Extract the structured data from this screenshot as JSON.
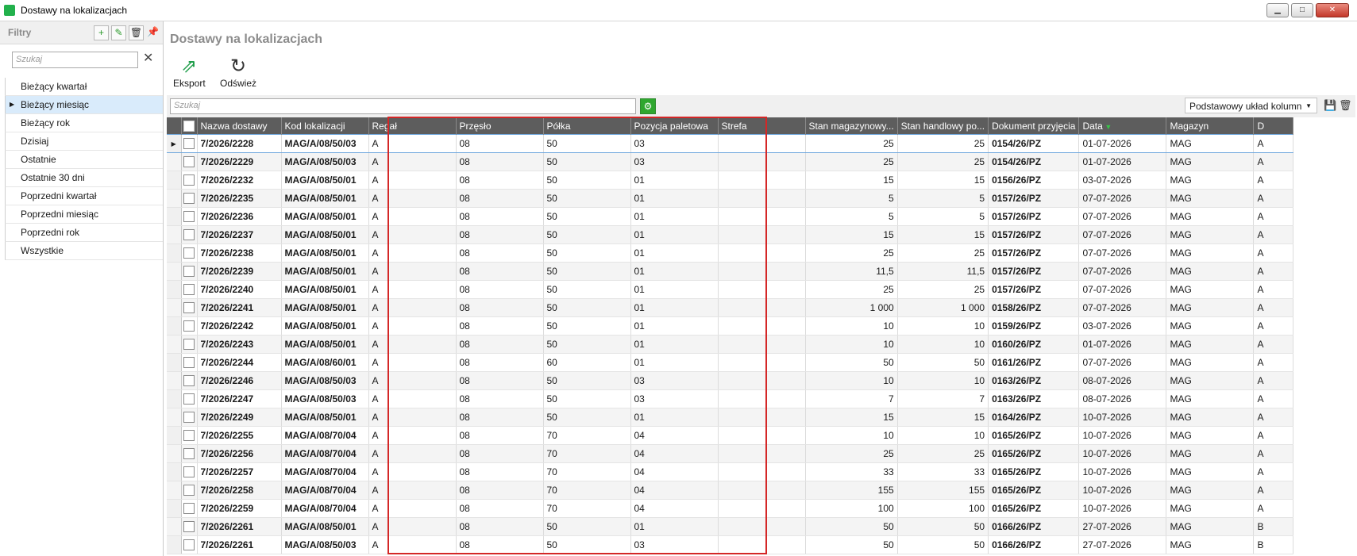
{
  "window": {
    "title": "Dostawy na lokalizacjach",
    "buttons": [
      "▁",
      "□",
      "✕"
    ]
  },
  "filters": {
    "title": "Filtry",
    "search_placeholder": "Szukaj",
    "items": [
      {
        "label": "Bieżący kwartał",
        "selected": false
      },
      {
        "label": "Bieżący miesiąc",
        "selected": true
      },
      {
        "label": "Bieżący rok",
        "selected": false
      },
      {
        "label": "Dzisiaj",
        "selected": false
      },
      {
        "label": "Ostatnie",
        "selected": false
      },
      {
        "label": "Ostatnie 30 dni",
        "selected": false
      },
      {
        "label": "Poprzedni kwartał",
        "selected": false
      },
      {
        "label": "Poprzedni miesiąc",
        "selected": false
      },
      {
        "label": "Poprzedni rok",
        "selected": false
      },
      {
        "label": "Wszystkie",
        "selected": false
      }
    ]
  },
  "page": {
    "title": "Dostawy na lokalizacjach"
  },
  "toolbar": {
    "export_label": "Eksport",
    "refresh_label": "Odśwież"
  },
  "grid": {
    "search_placeholder": "Szukaj",
    "layout_label": "Podstawowy układ kolumn",
    "columns": [
      "Nazwa dostawy",
      "Kod lokalizacji",
      "Regał",
      "Przęsło",
      "Półka",
      "Pozycja paletowa",
      "Strefa",
      "Stan magazynowy...",
      "Stan handlowy po...",
      "Dokument przyjęcia",
      "Data",
      "Magazyn",
      "D"
    ],
    "rows": [
      [
        "7/2026/2228",
        "MAG/A/08/50/03",
        "A",
        "08",
        "50",
        "03",
        "",
        "25",
        "25",
        "0154/26/PZ",
        "01-07-2026",
        "MAG",
        "A"
      ],
      [
        "7/2026/2229",
        "MAG/A/08/50/03",
        "A",
        "08",
        "50",
        "03",
        "",
        "25",
        "25",
        "0154/26/PZ",
        "01-07-2026",
        "MAG",
        "A"
      ],
      [
        "7/2026/2232",
        "MAG/A/08/50/01",
        "A",
        "08",
        "50",
        "01",
        "",
        "15",
        "15",
        "0156/26/PZ",
        "03-07-2026",
        "MAG",
        "A"
      ],
      [
        "7/2026/2235",
        "MAG/A/08/50/01",
        "A",
        "08",
        "50",
        "01",
        "",
        "5",
        "5",
        "0157/26/PZ",
        "07-07-2026",
        "MAG",
        "A"
      ],
      [
        "7/2026/2236",
        "MAG/A/08/50/01",
        "A",
        "08",
        "50",
        "01",
        "",
        "5",
        "5",
        "0157/26/PZ",
        "07-07-2026",
        "MAG",
        "A"
      ],
      [
        "7/2026/2237",
        "MAG/A/08/50/01",
        "A",
        "08",
        "50",
        "01",
        "",
        "15",
        "15",
        "0157/26/PZ",
        "07-07-2026",
        "MAG",
        "A"
      ],
      [
        "7/2026/2238",
        "MAG/A/08/50/01",
        "A",
        "08",
        "50",
        "01",
        "",
        "25",
        "25",
        "0157/26/PZ",
        "07-07-2026",
        "MAG",
        "A"
      ],
      [
        "7/2026/2239",
        "MAG/A/08/50/01",
        "A",
        "08",
        "50",
        "01",
        "",
        "11,5",
        "11,5",
        "0157/26/PZ",
        "07-07-2026",
        "MAG",
        "A"
      ],
      [
        "7/2026/2240",
        "MAG/A/08/50/01",
        "A",
        "08",
        "50",
        "01",
        "",
        "25",
        "25",
        "0157/26/PZ",
        "07-07-2026",
        "MAG",
        "A"
      ],
      [
        "7/2026/2241",
        "MAG/A/08/50/01",
        "A",
        "08",
        "50",
        "01",
        "",
        "1 000",
        "1 000",
        "0158/26/PZ",
        "07-07-2026",
        "MAG",
        "A"
      ],
      [
        "7/2026/2242",
        "MAG/A/08/50/01",
        "A",
        "08",
        "50",
        "01",
        "",
        "10",
        "10",
        "0159/26/PZ",
        "03-07-2026",
        "MAG",
        "A"
      ],
      [
        "7/2026/2243",
        "MAG/A/08/50/01",
        "A",
        "08",
        "50",
        "01",
        "",
        "10",
        "10",
        "0160/26/PZ",
        "01-07-2026",
        "MAG",
        "A"
      ],
      [
        "7/2026/2244",
        "MAG/A/08/60/01",
        "A",
        "08",
        "60",
        "01",
        "",
        "50",
        "50",
        "0161/26/PZ",
        "07-07-2026",
        "MAG",
        "A"
      ],
      [
        "7/2026/2246",
        "MAG/A/08/50/03",
        "A",
        "08",
        "50",
        "03",
        "",
        "10",
        "10",
        "0163/26/PZ",
        "08-07-2026",
        "MAG",
        "A"
      ],
      [
        "7/2026/2247",
        "MAG/A/08/50/03",
        "A",
        "08",
        "50",
        "03",
        "",
        "7",
        "7",
        "0163/26/PZ",
        "08-07-2026",
        "MAG",
        "A"
      ],
      [
        "7/2026/2249",
        "MAG/A/08/50/01",
        "A",
        "08",
        "50",
        "01",
        "",
        "15",
        "15",
        "0164/26/PZ",
        "10-07-2026",
        "MAG",
        "A"
      ],
      [
        "7/2026/2255",
        "MAG/A/08/70/04",
        "A",
        "08",
        "70",
        "04",
        "",
        "10",
        "10",
        "0165/26/PZ",
        "10-07-2026",
        "MAG",
        "A"
      ],
      [
        "7/2026/2256",
        "MAG/A/08/70/04",
        "A",
        "08",
        "70",
        "04",
        "",
        "25",
        "25",
        "0165/26/PZ",
        "10-07-2026",
        "MAG",
        "A"
      ],
      [
        "7/2026/2257",
        "MAG/A/08/70/04",
        "A",
        "08",
        "70",
        "04",
        "",
        "33",
        "33",
        "0165/26/PZ",
        "10-07-2026",
        "MAG",
        "A"
      ],
      [
        "7/2026/2258",
        "MAG/A/08/70/04",
        "A",
        "08",
        "70",
        "04",
        "",
        "155",
        "155",
        "0165/26/PZ",
        "10-07-2026",
        "MAG",
        "A"
      ],
      [
        "7/2026/2259",
        "MAG/A/08/70/04",
        "A",
        "08",
        "70",
        "04",
        "",
        "100",
        "100",
        "0165/26/PZ",
        "10-07-2026",
        "MAG",
        "A"
      ],
      [
        "7/2026/2261",
        "MAG/A/08/50/01",
        "A",
        "08",
        "50",
        "01",
        "",
        "50",
        "50",
        "0166/26/PZ",
        "27-07-2026",
        "MAG",
        "B"
      ],
      [
        "7/2026/2261",
        "MAG/A/08/50/03",
        "A",
        "08",
        "50",
        "03",
        "",
        "50",
        "50",
        "0166/26/PZ",
        "27-07-2026",
        "MAG",
        "B"
      ]
    ]
  },
  "colors": {
    "header_bg": "#5d5d5d",
    "highlight_border": "#d42727",
    "accent_green": "#2fa72f",
    "selection": "#d9ebfb"
  }
}
